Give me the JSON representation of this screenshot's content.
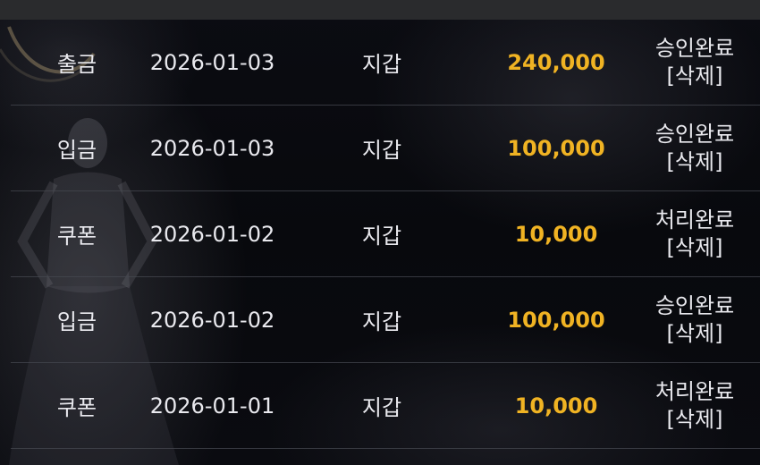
{
  "colors": {
    "amount": "#f0b323",
    "text": "#e9e9ee",
    "divider": "#46484f",
    "background": "#08090d"
  },
  "rows": [
    {
      "type": "출금",
      "date": "2026-01-03",
      "wallet": "지갑",
      "amount": "240,000",
      "status": "승인완료",
      "delete": "[삭제]"
    },
    {
      "type": "입금",
      "date": "2026-01-03",
      "wallet": "지갑",
      "amount": "100,000",
      "status": "승인완료",
      "delete": "[삭제]"
    },
    {
      "type": "쿠폰",
      "date": "2026-01-02",
      "wallet": "지갑",
      "amount": "10,000",
      "status": "처리완료",
      "delete": "[삭제]"
    },
    {
      "type": "입금",
      "date": "2026-01-02",
      "wallet": "지갑",
      "amount": "100,000",
      "status": "승인완료",
      "delete": "[삭제]"
    },
    {
      "type": "쿠폰",
      "date": "2026-01-01",
      "wallet": "지갑",
      "amount": "10,000",
      "status": "처리완료",
      "delete": "[삭제]"
    }
  ]
}
